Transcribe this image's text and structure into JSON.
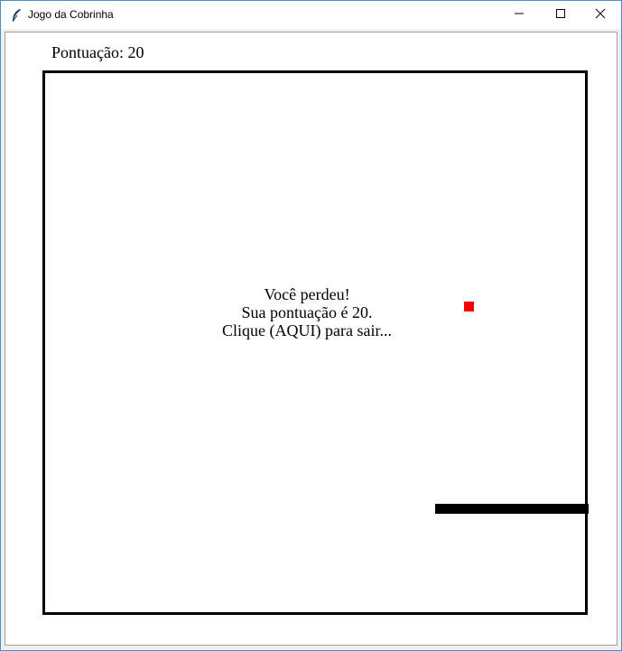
{
  "window": {
    "title": "Jogo da Cobrinha",
    "icon": "feather-icon"
  },
  "controls": {
    "minimize_icon": "minimize-icon",
    "maximize_icon": "maximize-icon",
    "close_icon": "close-icon"
  },
  "game": {
    "score_text": "Pontuação: 20",
    "message_lines": [
      "Você perdeu!",
      "Sua pontuação é 20.",
      "Clique (AQUI) para sair..."
    ],
    "food_color": "#ff0000",
    "snake_color": "#000000"
  }
}
